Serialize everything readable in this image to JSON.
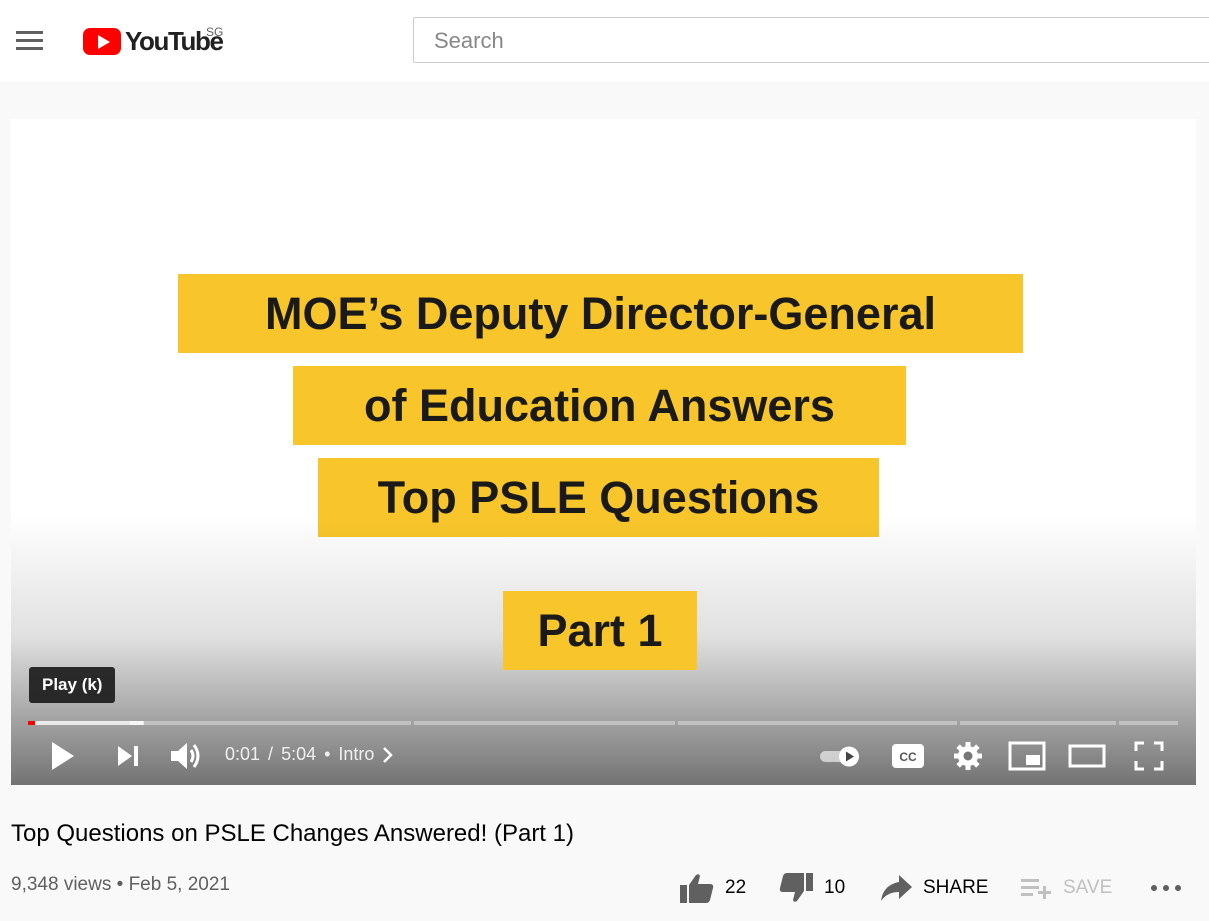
{
  "masthead": {
    "logo_text": "YouTube",
    "country_code": "SG",
    "search_placeholder": "Search"
  },
  "video": {
    "slide_lines": [
      "MOE’s Deputy Director-General",
      "of Education Answers",
      "Top PSLE Questions",
      "Part 1"
    ],
    "tooltip": "Play (k)",
    "current_time": "0:01",
    "duration": "5:04",
    "time_separator": "/",
    "chapter_dot": "•",
    "chapter": "Intro",
    "played_fraction": 0.003,
    "brand_color": "#ff0000",
    "slide_color": "#f8c62a"
  },
  "info": {
    "title": "Top Questions on PSLE Changes Answered! (Part 1)",
    "views": "9,348 views",
    "dot": "•",
    "date": "Feb 5, 2021",
    "likes": "22",
    "dislikes": "10",
    "share_label": "SHARE",
    "save_label": "SAVE"
  }
}
